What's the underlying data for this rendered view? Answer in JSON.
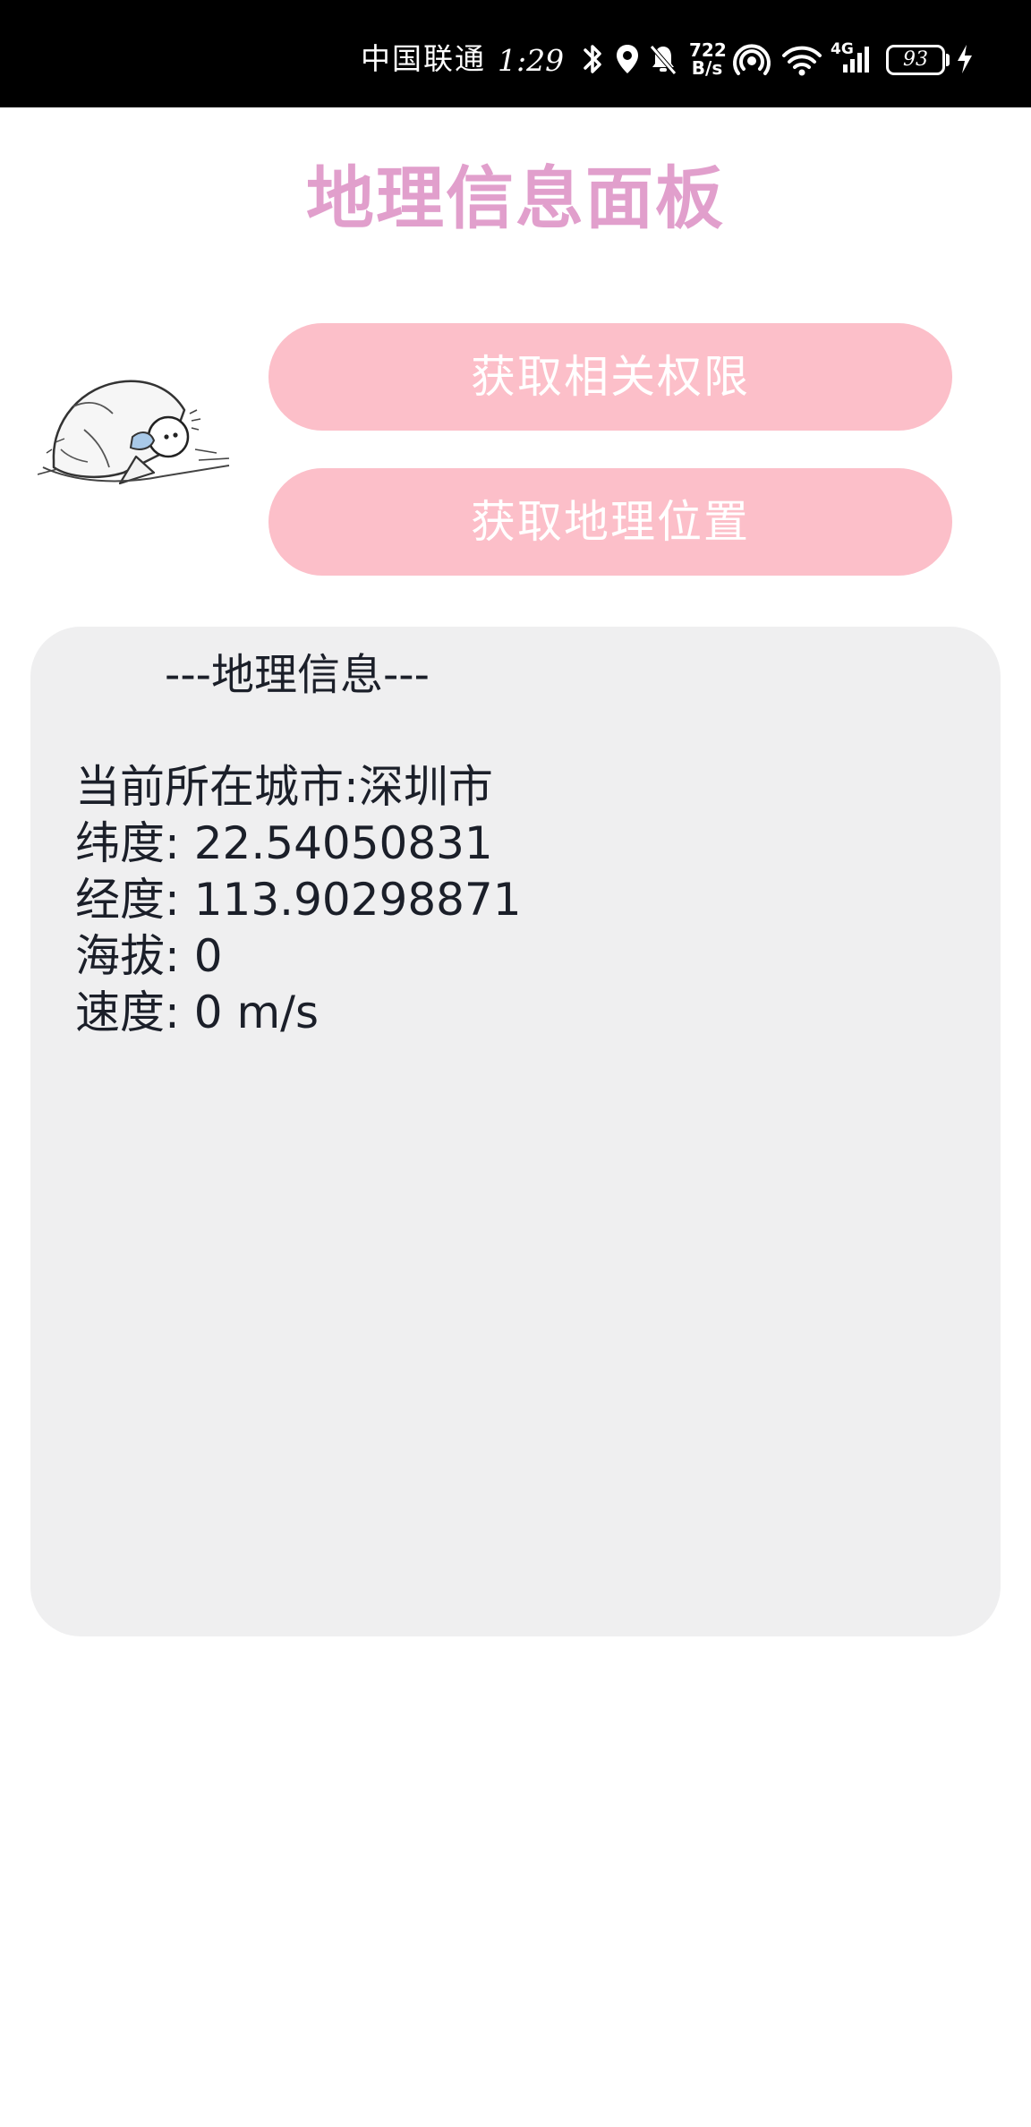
{
  "status_bar": {
    "carrier": "中国联通",
    "time": "1:29",
    "net_speed_value": "722",
    "net_speed_unit": "B/s",
    "network_type": "4G",
    "battery_level": "93",
    "icons": [
      "bluetooth-icon",
      "location-icon",
      "bell-muted-icon",
      "hotspot-icon",
      "wifi-icon",
      "signal-icon",
      "battery-icon",
      "charging-icon"
    ]
  },
  "page": {
    "title": "地理信息面板"
  },
  "buttons": {
    "get_permissions": "获取相关权限",
    "get_location": "获取地理位置"
  },
  "info": {
    "heading": "---地理信息---",
    "city_line": "当前所在城市:深圳市",
    "latitude_line": "纬度: 22.54050831",
    "longitude_line": "经度: 113.90298871",
    "altitude_line": "海拔: 0",
    "speed_line": "速度: 0 m/s"
  },
  "colors": {
    "title": "#e19fcc",
    "button_bg": "#fcbfc9",
    "button_text": "#ffffff",
    "card_bg": "#efeff0",
    "text": "#1b1f29",
    "status_bar_bg": "#000000"
  }
}
